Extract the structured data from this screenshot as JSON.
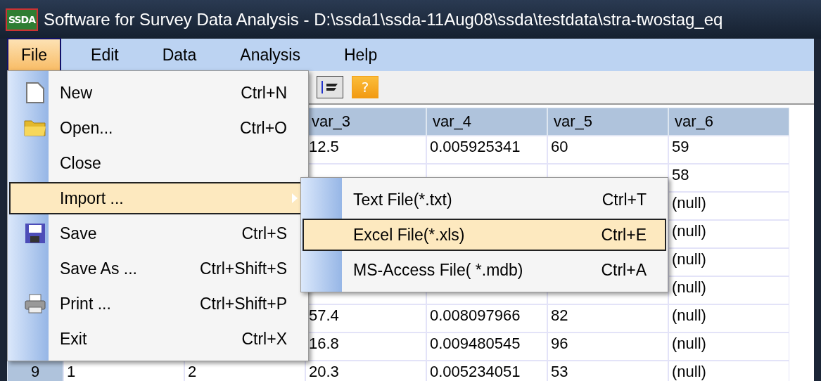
{
  "window": {
    "title": "Software for Survey Data Analysis - D:\\ssda1\\ssda-11Aug08\\ssda\\testdata\\stra-twostag_eq",
    "logo": "SSDA"
  },
  "menu_bar": [
    {
      "label": "File",
      "selected": true
    },
    {
      "label": "Edit",
      "selected": false
    },
    {
      "label": "Data",
      "selected": false
    },
    {
      "label": "Analysis",
      "selected": false
    },
    {
      "label": "Help",
      "selected": false
    }
  ],
  "toolbar": [
    {
      "kind": "sort"
    },
    {
      "kind": "help",
      "glyph": "?"
    }
  ],
  "grid": {
    "columns": [
      "var_3",
      "var_4",
      "var_5",
      "var_6"
    ],
    "rows": [
      {
        "cells": [
          "12.5",
          "0.005925341",
          "60",
          "59"
        ]
      },
      {
        "cells": [
          "",
          "",
          "",
          "58"
        ]
      },
      {
        "cells": [
          "",
          "",
          "",
          "(null)"
        ]
      },
      {
        "cells": [
          "",
          "",
          "",
          "(null)"
        ]
      },
      {
        "cells": [
          "",
          "",
          "",
          "(null)"
        ]
      },
      {
        "cells": [
          "",
          "",
          "",
          "(null)"
        ]
      },
      {
        "cells": [
          "57.4",
          "0.008097966",
          "82",
          "(null)"
        ]
      },
      {
        "cells": [
          "16.8",
          "0.009480545",
          "96",
          "(null)"
        ]
      },
      {
        "header": "9",
        "lead": [
          "1",
          "2"
        ],
        "cells": [
          "20.3",
          "0.005234051",
          "53",
          "(null)"
        ]
      }
    ]
  },
  "file_menu": [
    {
      "kind": "new",
      "label": "New",
      "shortcut": "Ctrl+N",
      "highlighted": false,
      "submenu": false
    },
    {
      "kind": "open",
      "label": "Open...",
      "shortcut": "Ctrl+O",
      "highlighted": false,
      "submenu": false
    },
    {
      "kind": "plain",
      "label": "Close",
      "highlighted": false,
      "submenu": false
    },
    {
      "kind": "plain",
      "label": "Import ...",
      "highlighted": true,
      "submenu": true
    },
    {
      "kind": "save",
      "label": "Save",
      "shortcut": "Ctrl+S",
      "highlighted": false,
      "submenu": false
    },
    {
      "kind": "plain",
      "label": "Save As ...",
      "shortcut": "Ctrl+Shift+S",
      "highlighted": false,
      "submenu": false
    },
    {
      "kind": "print",
      "label": "Print ...",
      "shortcut": "Ctrl+Shift+P",
      "highlighted": false,
      "submenu": false
    },
    {
      "kind": "plain",
      "label": "Exit",
      "shortcut": "Ctrl+X",
      "highlighted": false,
      "submenu": false
    }
  ],
  "import_submenu": [
    {
      "label": "Text File(*.txt)",
      "shortcut": "Ctrl+T",
      "highlighted": false
    },
    {
      "label": "Excel File(*.xls)",
      "shortcut": "Ctrl+E",
      "highlighted": true
    },
    {
      "label": "MS-Access File( *.mdb)",
      "shortcut": "Ctrl+A",
      "highlighted": false
    }
  ]
}
